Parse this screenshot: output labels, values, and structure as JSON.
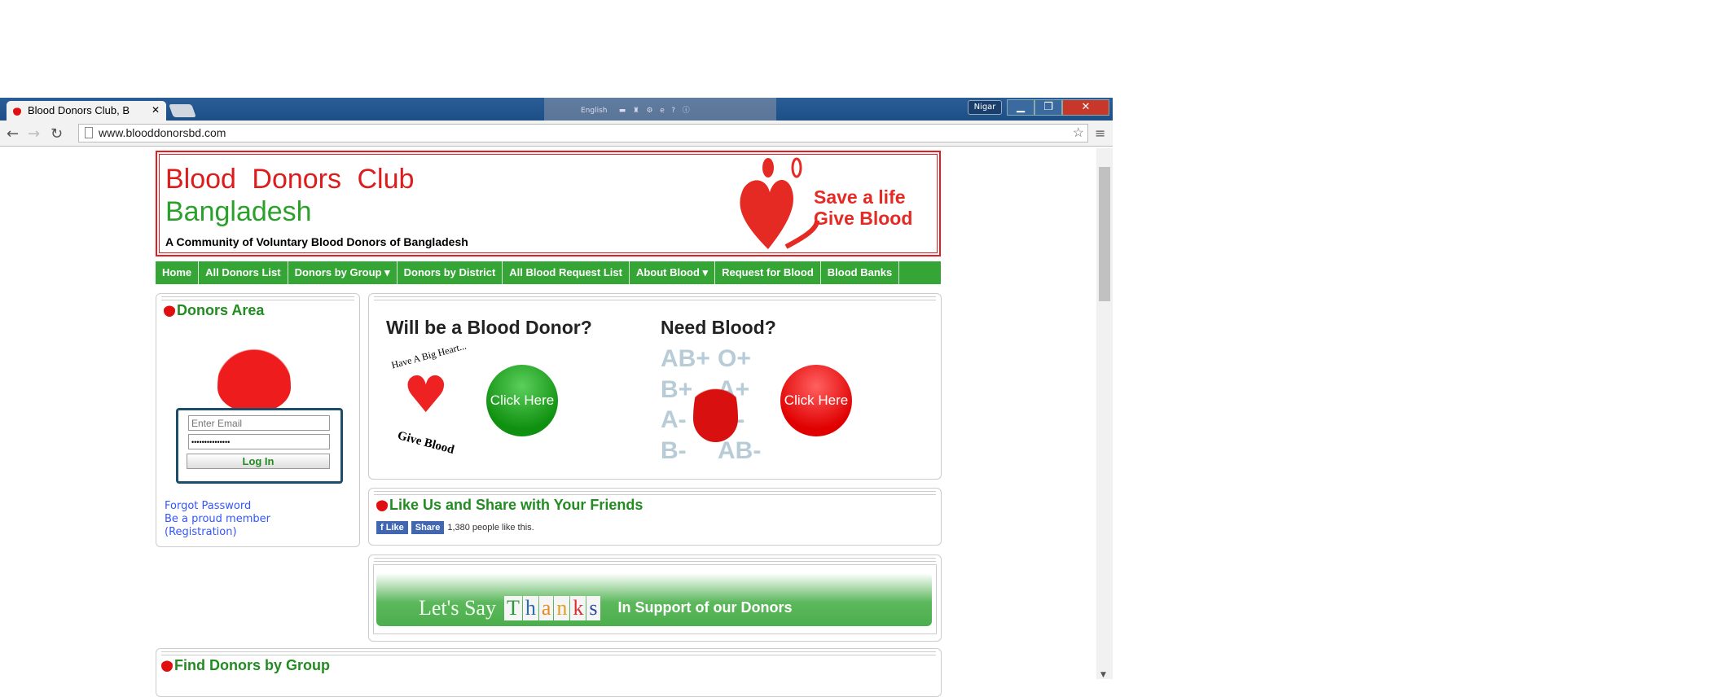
{
  "browser": {
    "tab_title": "Blood Donors Club, B",
    "url": "www.blooddonorsbd.com",
    "user": "Nigar",
    "tray_lang": "English"
  },
  "header": {
    "title_line1": "Blood Donors Club",
    "title_line2": "Bangladesh",
    "tagline": "A Community of Voluntary Blood Donors of Bangladesh",
    "logo_line1": "Save a life",
    "logo_line2": "Give Blood"
  },
  "nav": [
    "Home",
    "All Donors List",
    "Donors by Group ▾",
    "Donors by District",
    "All Blood Request List",
    "About Blood ▾",
    "Request for Blood",
    "Blood Banks"
  ],
  "donors_area": {
    "title": "Donors Area",
    "email_placeholder": "Enter Email",
    "password_value": "•••••••••••••••",
    "login": "Log In",
    "forgot": "Forgot Password",
    "member": "Be a proud member",
    "registration": "(Registration)"
  },
  "cta": {
    "donor_title": "Will be a Blood Donor?",
    "donor_img_top": "Have A Big Heart...",
    "donor_img_bottom": "Give Blood",
    "need_title": "Need Blood?",
    "click": "Click Here",
    "groups": [
      "AB+",
      "O+",
      "B+",
      "A+",
      "A-",
      "O-",
      "B-",
      "AB-"
    ]
  },
  "social": {
    "title": "Like Us and Share with Your Friends",
    "like": "Like",
    "share": "Share",
    "count": "1,380 people like this."
  },
  "thanks": {
    "left": "Let's Say",
    "word": [
      "T",
      "h",
      "a",
      "n",
      "k",
      "s"
    ],
    "right": "In Support of our Donors"
  },
  "find": {
    "title": "Find Donors by Group"
  }
}
